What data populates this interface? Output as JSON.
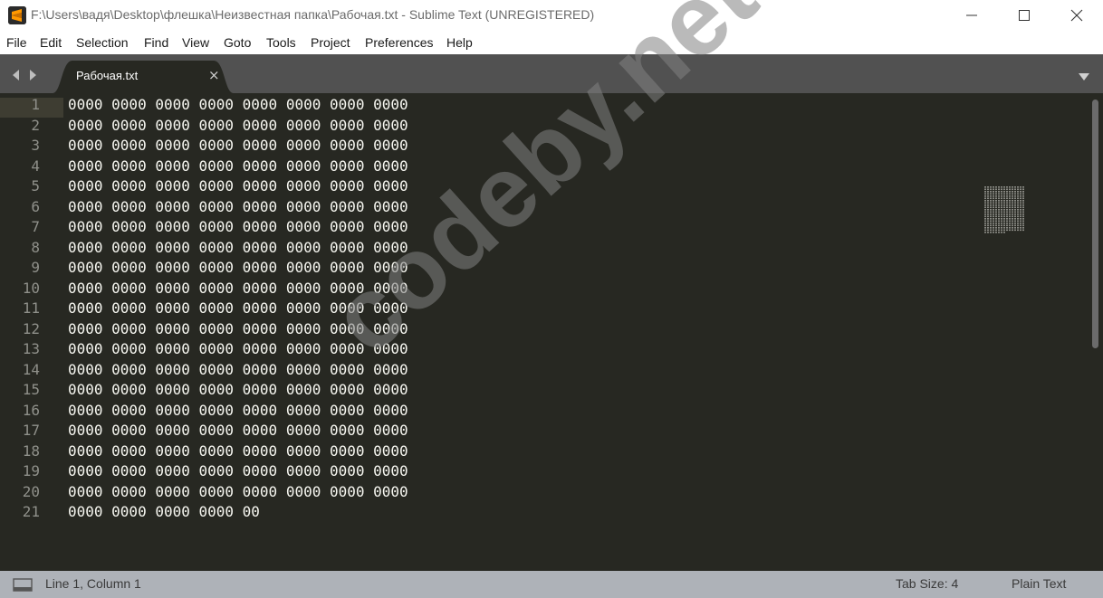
{
  "window": {
    "title": "F:\\Users\\вадя\\Desktop\\флешка\\Неизвестная папка\\Рабочая.txt - Sublime Text (UNREGISTERED)"
  },
  "menu": [
    "File",
    "Edit",
    "Selection",
    "Find",
    "View",
    "Goto",
    "Tools",
    "Project",
    "Preferences",
    "Help"
  ],
  "tab": {
    "label": "Рабочая.txt",
    "close": "×"
  },
  "editor": {
    "line_numbers": [
      "1",
      "2",
      "3",
      "4",
      "5",
      "6",
      "7",
      "8",
      "9",
      "10",
      "11",
      "12",
      "13",
      "14",
      "15",
      "16",
      "17",
      "18",
      "19",
      "20",
      "21"
    ],
    "lines": [
      "0000 0000 0000 0000 0000 0000 0000 0000",
      "0000 0000 0000 0000 0000 0000 0000 0000",
      "0000 0000 0000 0000 0000 0000 0000 0000",
      "0000 0000 0000 0000 0000 0000 0000 0000",
      "0000 0000 0000 0000 0000 0000 0000 0000",
      "0000 0000 0000 0000 0000 0000 0000 0000",
      "0000 0000 0000 0000 0000 0000 0000 0000",
      "0000 0000 0000 0000 0000 0000 0000 0000",
      "0000 0000 0000 0000 0000 0000 0000 0000",
      "0000 0000 0000 0000 0000 0000 0000 0000",
      "0000 0000 0000 0000 0000 0000 0000 0000",
      "0000 0000 0000 0000 0000 0000 0000 0000",
      "0000 0000 0000 0000 0000 0000 0000 0000",
      "0000 0000 0000 0000 0000 0000 0000 0000",
      "0000 0000 0000 0000 0000 0000 0000 0000",
      "0000 0000 0000 0000 0000 0000 0000 0000",
      "0000 0000 0000 0000 0000 0000 0000 0000",
      "0000 0000 0000 0000 0000 0000 0000 0000",
      "0000 0000 0000 0000 0000 0000 0000 0000",
      "0000 0000 0000 0000 0000 0000 0000 0000",
      "0000 0000 0000 0000 00"
    ]
  },
  "watermark": "codeby.net",
  "status": {
    "position": "Line 1, Column 1",
    "tab_size": "Tab Size: 4",
    "syntax": "Plain Text"
  },
  "colors": {
    "editor_bg": "#272822",
    "gutter_fg": "#8f908a",
    "text_fg": "#f8f8f2",
    "tabbar_bg": "#515151",
    "statusbar_bg": "#aeb2b8",
    "app_icon_accent": "#ff9800"
  },
  "icons": {
    "app": "sublime-text-icon",
    "minimize": "minimize-icon",
    "maximize": "maximize-icon",
    "close": "close-icon",
    "nav": "tab-nav-arrows-icon",
    "dropdown": "tab-dropdown-icon",
    "panel": "panel-toggle-icon"
  }
}
